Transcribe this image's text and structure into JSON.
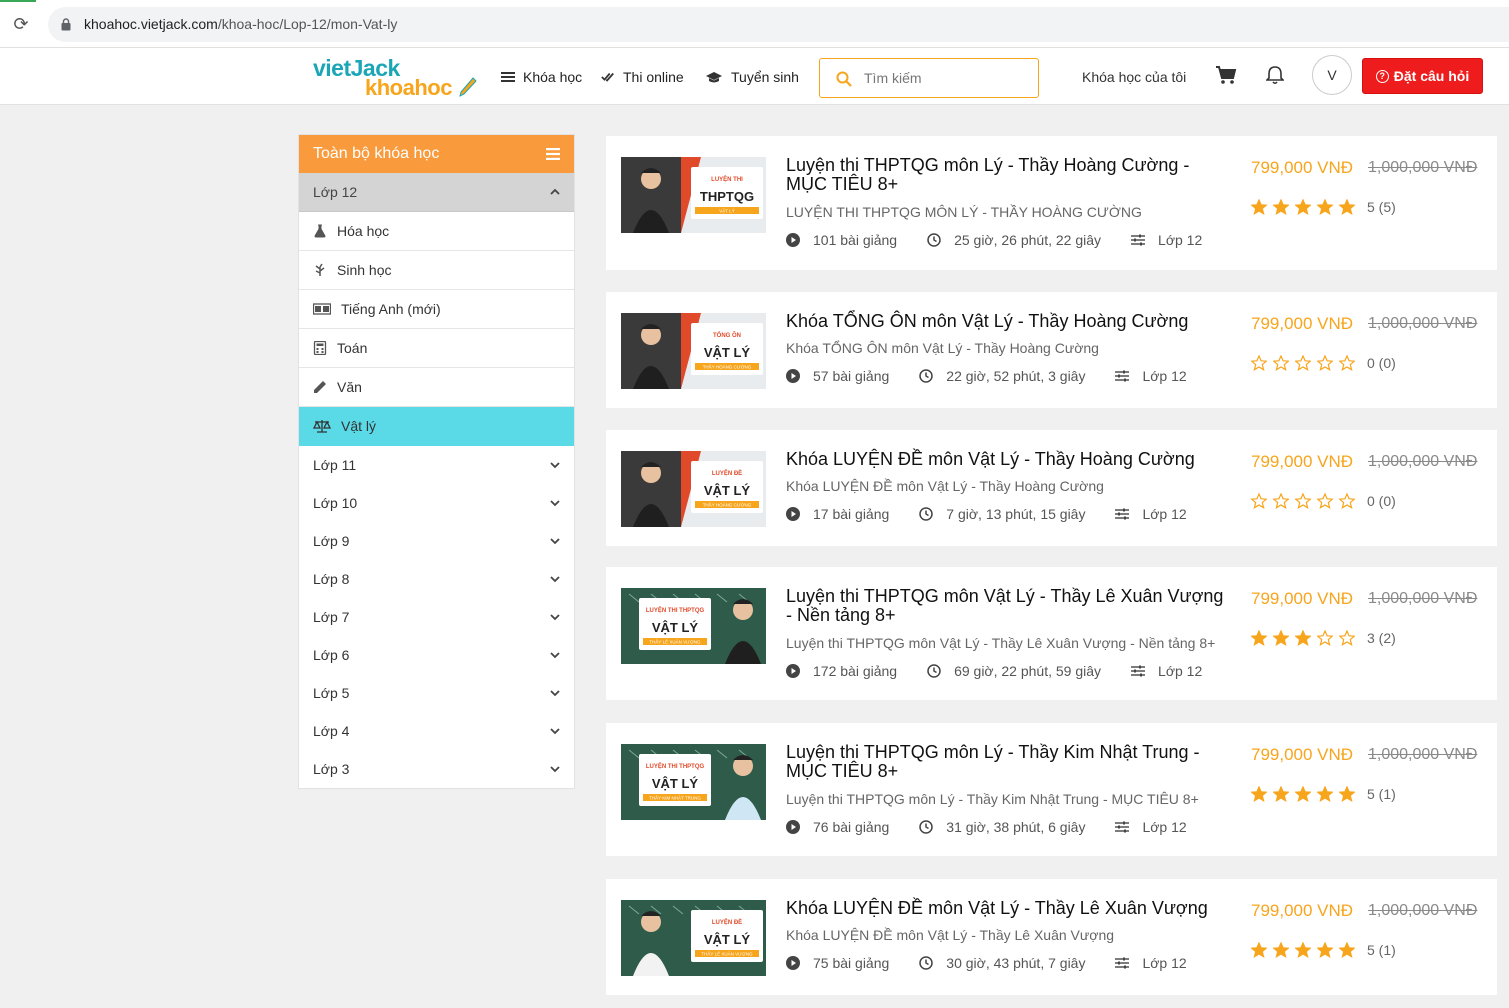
{
  "browser": {
    "url_host": "khoahoc.vietjack.com",
    "url_path": "/khoa-hoc/Lop-12/mon-Vat-ly"
  },
  "header": {
    "logo_top": "vietJack",
    "logo_bottom": "khoahoc",
    "nav": [
      {
        "label": "Khóa học",
        "icon": "list-icon"
      },
      {
        "label": "Thi online",
        "icon": "double-check-icon"
      },
      {
        "label": "Tuyển sinh",
        "icon": "graduation-cap-icon"
      }
    ],
    "search_placeholder": "Tìm kiếm",
    "my_courses": "Khóa học của tôi",
    "avatar_letter": "V",
    "ask_button": "Đặt câu hỏi"
  },
  "sidebar": {
    "title": "Toàn bộ khóa học",
    "open_grade": "Lớp 12",
    "subjects": [
      {
        "label": "Hóa học",
        "icon": "flask-icon"
      },
      {
        "label": "Sinh học",
        "icon": "leaf-icon"
      },
      {
        "label": "Tiếng Anh (mới)",
        "icon": "language-icon"
      },
      {
        "label": "Toán",
        "icon": "calculator-icon"
      },
      {
        "label": "Văn",
        "icon": "pencil-icon"
      },
      {
        "label": "Vật lý",
        "icon": "scale-icon",
        "active": true
      }
    ],
    "grades": [
      "Lớp 11",
      "Lớp 10",
      "Lớp 9",
      "Lớp 8",
      "Lớp 7",
      "Lớp 6",
      "Lớp 5",
      "Lớp 4",
      "Lớp 3"
    ]
  },
  "courses": [
    {
      "title": "Luyện thi THPTQG môn Lý - Thầy Hoàng Cường - MỤC TIÊU 8+",
      "subtitle": "LUYỆN THI THPTQG MÔN LÝ - THẦY HOÀNG CƯỜNG",
      "lessons": "101 bài giảng",
      "duration": "25 giờ, 26 phút, 22 giây",
      "grade": "Lớp 12",
      "price": "799,000 VNĐ",
      "old_price": "1,000,000 VNĐ",
      "stars": 5,
      "rating": "5 (5)",
      "thumb_lines": [
        "LUYỆN THI",
        "THPTQG",
        "VẬT LÝ"
      ]
    },
    {
      "title": "Khóa TỔNG ÔN môn Vật Lý - Thầy Hoàng Cường",
      "subtitle": "Khóa TỔNG ÔN môn Vật Lý - Thầy Hoàng Cường",
      "lessons": "57 bài giảng",
      "duration": "22 giờ, 52 phút, 3 giây",
      "grade": "Lớp 12",
      "price": "799,000 VNĐ",
      "old_price": "1,000,000 VNĐ",
      "stars": 0,
      "rating": "0 (0)",
      "thumb_lines": [
        "TỔNG ÔN",
        "VẬT LÝ",
        "THẦY HOÀNG CƯỜNG"
      ]
    },
    {
      "title": "Khóa LUYỆN ĐỀ môn Vật Lý - Thầy Hoàng Cường",
      "subtitle": "Khóa LUYỆN ĐỀ môn Vật Lý - Thầy Hoàng Cường",
      "lessons": "17 bài giảng",
      "duration": "7 giờ, 13 phút, 15 giây",
      "grade": "Lớp 12",
      "price": "799,000 VNĐ",
      "old_price": "1,000,000 VNĐ",
      "stars": 0,
      "rating": "0 (0)",
      "thumb_lines": [
        "LUYỆN ĐỀ",
        "VẬT LÝ",
        "THẦY HOÀNG CƯỜNG"
      ]
    },
    {
      "title": "Luyện thi THPTQG môn Vật Lý - Thầy Lê Xuân Vượng - Nền tảng 8+",
      "subtitle": "Luyện thi THPTQG môn Vật Lý - Thầy Lê Xuân Vượng - Nền tảng 8+",
      "lessons": "172 bài giảng",
      "duration": "69 giờ, 22 phút, 59 giây",
      "grade": "Lớp 12",
      "price": "799,000 VNĐ",
      "old_price": "1,000,000 VNĐ",
      "stars": 3,
      "rating": "3 (2)",
      "thumb_lines": [
        "LUYỆN THI THPTQG",
        "VẬT LÝ",
        "THẦY LÊ XUÂN VƯỢNG"
      ]
    },
    {
      "title": "Luyện thi THPTQG môn Lý - Thầy Kim Nhật Trung - MỤC TIÊU 8+",
      "subtitle": "Luyện thi THPTQG môn Lý - Thầy Kim Nhật Trung - MỤC TIÊU 8+",
      "lessons": "76 bài giảng",
      "duration": "31 giờ, 38 phút, 6 giây",
      "grade": "Lớp 12",
      "price": "799,000 VNĐ",
      "old_price": "1,000,000 VNĐ",
      "stars": 5,
      "rating": "5 (1)",
      "thumb_lines": [
        "LUYỆN THI THPTQG",
        "VẬT LÝ",
        "THẦY KIM NHẬT TRUNG"
      ]
    },
    {
      "title": "Khóa LUYỆN ĐỀ môn Vật Lý - Thầy Lê Xuân Vượng",
      "subtitle": "Khóa LUYỆN ĐỀ môn Vật Lý - Thầy Lê Xuân Vượng",
      "lessons": "75 bài giảng",
      "duration": "30 giờ, 43 phút, 7 giây",
      "grade": "Lớp 12",
      "price": "799,000 VNĐ",
      "old_price": "1,000,000 VNĐ",
      "stars": 5,
      "rating": "5 (1)",
      "thumb_lines": [
        "LUYỆN ĐỀ",
        "VẬT LÝ",
        "THẦY LÊ XUÂN VƯỢNG"
      ]
    }
  ],
  "colors": {
    "accent_orange": "#f7a51c",
    "sidebar_head": "#f99b3d",
    "active_subject": "#5ad9e6",
    "brand_teal": "#1aa6b7",
    "ask_red": "#ee1c1c",
    "star": "#f7a51c"
  }
}
